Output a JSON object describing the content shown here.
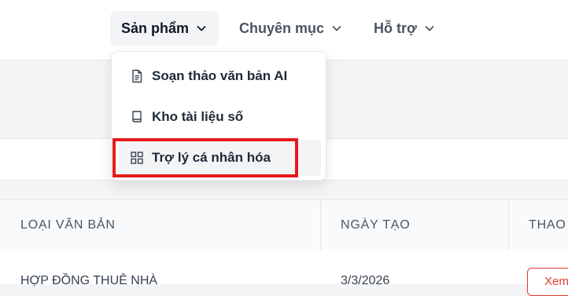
{
  "nav": {
    "items": [
      {
        "label": "Sản phẩm"
      },
      {
        "label": "Chuyên mục"
      },
      {
        "label": "Hỗ trợ"
      }
    ]
  },
  "dropdown": {
    "items": [
      {
        "label": "Soạn thảo văn bản AI",
        "icon": "document-icon"
      },
      {
        "label": "Kho tài liệu số",
        "icon": "book-icon"
      },
      {
        "label": "Trợ lý cá nhân hóa",
        "icon": "grid-icon"
      }
    ]
  },
  "table": {
    "headers": [
      "LOẠI VĂN BẢN",
      "NGÀY TẠO",
      "THAO"
    ],
    "rows": [
      {
        "type": "HỢP ĐỒNG THUÊ NHÀ",
        "date": "3/3/2026",
        "action": "Xem"
      }
    ]
  },
  "colors": {
    "highlight": "#e41b1b",
    "action": "#e53935"
  }
}
